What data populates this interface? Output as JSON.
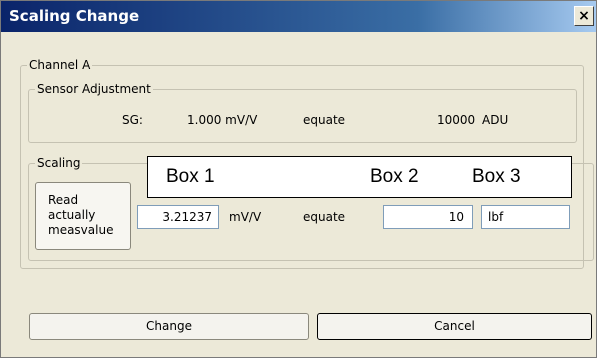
{
  "window": {
    "title": "Scaling Change",
    "close_glyph": "×"
  },
  "channel_group": {
    "legend": "Channel A"
  },
  "sensor_group": {
    "legend": "Sensor Adjustment",
    "sg_label": "SG:",
    "sg_value": "1.000 mV/V",
    "equate_label": "equate",
    "adu_value": "10000",
    "adu_unit": "ADU"
  },
  "scaling_group": {
    "legend": "Scaling",
    "read_button_label": "Read\nactually\nmeasvalue",
    "mv_input_value": "3.21237",
    "mv_unit": "mV/V",
    "equate_label": "equate",
    "value_input": "10",
    "unit_input": "lbf"
  },
  "annotation": {
    "box1": "Box 1",
    "box2": "Box 2",
    "box3": "Box 3"
  },
  "footer": {
    "change_label": "Change",
    "cancel_label": "Cancel"
  },
  "colors": {
    "titlebar_start": "#0a246a",
    "titlebar_end": "#a6caf0",
    "dialog_bg": "#ece9d8",
    "input_border": "#7f9db9"
  }
}
